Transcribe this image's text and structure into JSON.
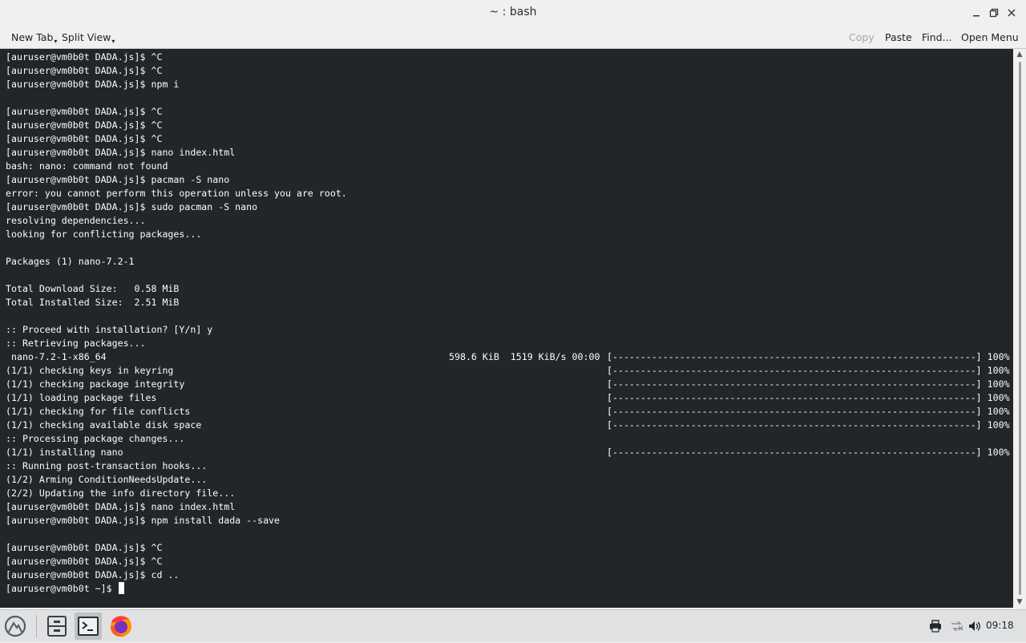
{
  "window": {
    "title": "~ : bash"
  },
  "toolbar": {
    "new_tab": "New Tab",
    "split_view": "Split View",
    "copy": "Copy",
    "paste": "Paste",
    "find": "Find...",
    "open_menu": "Open Menu"
  },
  "terminal": {
    "background": "#232629",
    "foreground": "#fcfcfc",
    "lines": [
      "[auruser@vm0b0t DADA.js]$ ^C",
      "[auruser@vm0b0t DADA.js]$ ^C",
      "[auruser@vm0b0t DADA.js]$ npm i",
      "",
      "[auruser@vm0b0t DADA.js]$ ^C",
      "[auruser@vm0b0t DADA.js]$ ^C",
      "[auruser@vm0b0t DADA.js]$ ^C",
      "[auruser@vm0b0t DADA.js]$ nano index.html",
      "bash: nano: command not found",
      "[auruser@vm0b0t DADA.js]$ pacman -S nano",
      "error: you cannot perform this operation unless you are root.",
      "[auruser@vm0b0t DADA.js]$ sudo pacman -S nano",
      "resolving dependencies...",
      "looking for conflicting packages...",
      "",
      "Packages (1) nano-7.2-1",
      "",
      "Total Download Size:   0.58 MiB",
      "Total Installed Size:  2.51 MiB",
      "",
      ":: Proceed with installation? [Y/n] y",
      ":: Retrieving packages...",
      {
        "text": " nano-7.2-1-x86_64",
        "mid": "598.6 KiB  1519 KiB/s 00:00",
        "bar": "[-----------------------------------------------------------------] 100%"
      },
      {
        "text": "(1/1) checking keys in keyring",
        "bar": "[-----------------------------------------------------------------] 100%"
      },
      {
        "text": "(1/1) checking package integrity",
        "bar": "[-----------------------------------------------------------------] 100%"
      },
      {
        "text": "(1/1) loading package files",
        "bar": "[-----------------------------------------------------------------] 100%"
      },
      {
        "text": "(1/1) checking for file conflicts",
        "bar": "[-----------------------------------------------------------------] 100%"
      },
      {
        "text": "(1/1) checking available disk space",
        "bar": "[-----------------------------------------------------------------] 100%"
      },
      ":: Processing package changes...",
      {
        "text": "(1/1) installing nano",
        "bar": "[-----------------------------------------------------------------] 100%"
      },
      ":: Running post-transaction hooks...",
      "(1/2) Arming ConditionNeedsUpdate...",
      "(2/2) Updating the info directory file...",
      "[auruser@vm0b0t DADA.js]$ nano index.html",
      "[auruser@vm0b0t DADA.js]$ npm install dada --save",
      "",
      "[auruser@vm0b0t DADA.js]$ ^C",
      "[auruser@vm0b0t DADA.js]$ ^C",
      "[auruser@vm0b0t DADA.js]$ cd ..",
      {
        "text": "[auruser@vm0b0t ~]$ ",
        "cursor": true
      }
    ]
  },
  "scrollbar": {
    "thumb_start_fraction": 0.0,
    "visible_fraction": 1.0
  },
  "taskbar": {
    "items": [
      {
        "name": "application-launcher-icon",
        "active": false
      },
      {
        "name": "file-manager-icon",
        "active": false
      },
      {
        "name": "terminal-icon",
        "active": true
      },
      {
        "name": "firefox-icon",
        "active": false
      }
    ],
    "tray": [
      "printer-icon",
      "network-icon",
      "volume-icon"
    ],
    "clock": "09:18"
  }
}
